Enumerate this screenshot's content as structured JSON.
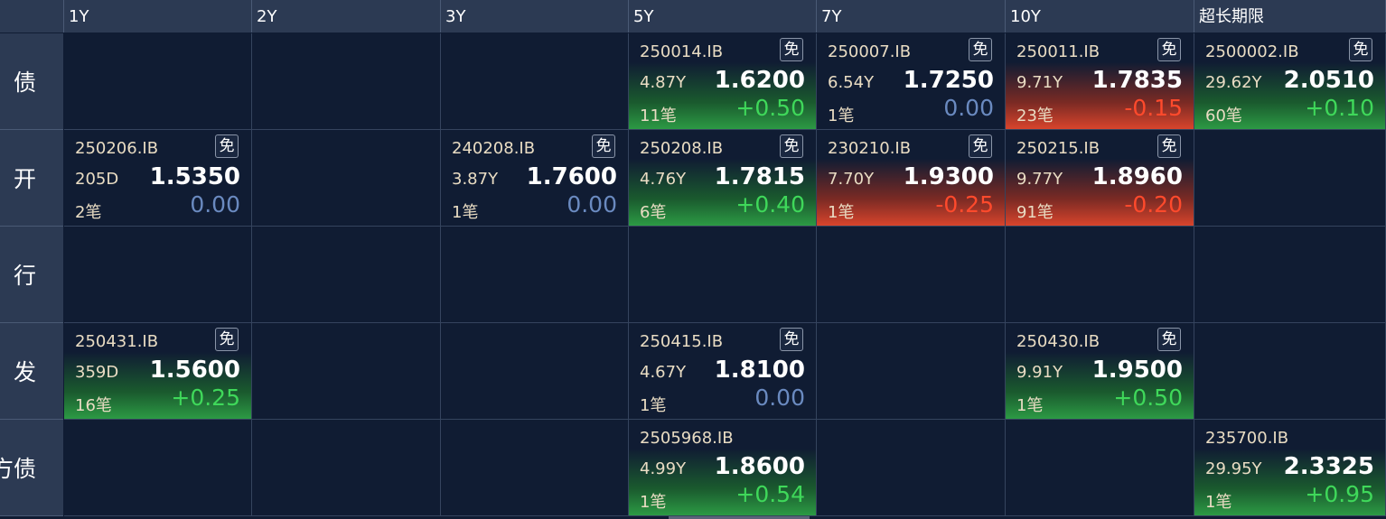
{
  "free_badge": "免",
  "columns": [
    "",
    "1Y",
    "2Y",
    "3Y",
    "5Y",
    "7Y",
    "10Y",
    "超长期限"
  ],
  "rows": [
    {
      "label": "债",
      "cells": [
        null,
        null,
        null,
        {
          "code": "250014.IB",
          "free": true,
          "term": "4.87Y",
          "price": "1.6200",
          "deals": "11笔",
          "change": "+0.50",
          "trend": "up"
        },
        {
          "code": "250007.IB",
          "free": true,
          "term": "6.54Y",
          "price": "1.7250",
          "deals": "1笔",
          "change": "0.00",
          "trend": "flat"
        },
        {
          "code": "250011.IB",
          "free": true,
          "term": "9.71Y",
          "price": "1.7835",
          "deals": "23笔",
          "change": "-0.15",
          "trend": "down"
        },
        {
          "code": "2500002.IB",
          "free": true,
          "term": "29.62Y",
          "price": "2.0510",
          "deals": "60笔",
          "change": "+0.10",
          "trend": "up"
        }
      ]
    },
    {
      "label": "开",
      "cells": [
        {
          "code": "250206.IB",
          "free": true,
          "term": "205D",
          "price": "1.5350",
          "deals": "2笔",
          "change": "0.00",
          "trend": "flat"
        },
        null,
        {
          "code": "240208.IB",
          "free": true,
          "term": "3.87Y",
          "price": "1.7600",
          "deals": "1笔",
          "change": "0.00",
          "trend": "flat"
        },
        {
          "code": "250208.IB",
          "free": true,
          "term": "4.76Y",
          "price": "1.7815",
          "deals": "6笔",
          "change": "+0.40",
          "trend": "up"
        },
        {
          "code": "230210.IB",
          "free": true,
          "term": "7.70Y",
          "price": "1.9300",
          "deals": "1笔",
          "change": "-0.25",
          "trend": "down"
        },
        {
          "code": "250215.IB",
          "free": true,
          "term": "9.77Y",
          "price": "1.8960",
          "deals": "91笔",
          "change": "-0.20",
          "trend": "down"
        },
        null
      ]
    },
    {
      "label": "行",
      "cells": [
        null,
        null,
        null,
        null,
        null,
        null,
        null
      ]
    },
    {
      "label": "发",
      "cells": [
        {
          "code": "250431.IB",
          "free": true,
          "term": "359D",
          "price": "1.5600",
          "deals": "16笔",
          "change": "+0.25",
          "trend": "up"
        },
        null,
        null,
        {
          "code": "250415.IB",
          "free": true,
          "term": "4.67Y",
          "price": "1.8100",
          "deals": "1笔",
          "change": "0.00",
          "trend": "flat"
        },
        null,
        {
          "code": "250430.IB",
          "free": true,
          "term": "9.91Y",
          "price": "1.9500",
          "deals": "1笔",
          "change": "+0.50",
          "trend": "up"
        },
        null
      ]
    },
    {
      "label": "方债",
      "cells": [
        null,
        null,
        null,
        {
          "code": "2505968.IB",
          "free": false,
          "term": "4.99Y",
          "price": "1.8600",
          "deals": "1笔",
          "change": "+0.54",
          "trend": "up"
        },
        null,
        null,
        {
          "code": "235700.IB",
          "free": false,
          "term": "29.95Y",
          "price": "2.3325",
          "deals": "1笔",
          "change": "+0.95",
          "trend": "up"
        }
      ]
    }
  ]
}
